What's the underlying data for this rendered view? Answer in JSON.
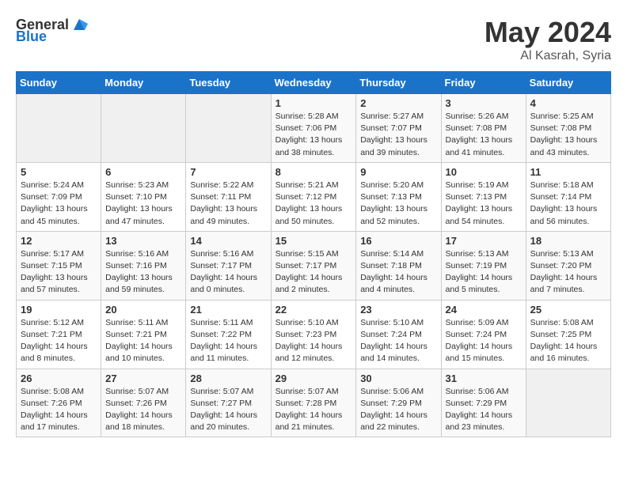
{
  "header": {
    "logo_general": "General",
    "logo_blue": "Blue",
    "title": "May 2024",
    "subtitle": "Al Kasrah, Syria"
  },
  "weekdays": [
    "Sunday",
    "Monday",
    "Tuesday",
    "Wednesday",
    "Thursday",
    "Friday",
    "Saturday"
  ],
  "weeks": [
    [
      {
        "day": "",
        "info": ""
      },
      {
        "day": "",
        "info": ""
      },
      {
        "day": "",
        "info": ""
      },
      {
        "day": "1",
        "info": "Sunrise: 5:28 AM\nSunset: 7:06 PM\nDaylight: 13 hours\nand 38 minutes."
      },
      {
        "day": "2",
        "info": "Sunrise: 5:27 AM\nSunset: 7:07 PM\nDaylight: 13 hours\nand 39 minutes."
      },
      {
        "day": "3",
        "info": "Sunrise: 5:26 AM\nSunset: 7:08 PM\nDaylight: 13 hours\nand 41 minutes."
      },
      {
        "day": "4",
        "info": "Sunrise: 5:25 AM\nSunset: 7:08 PM\nDaylight: 13 hours\nand 43 minutes."
      }
    ],
    [
      {
        "day": "5",
        "info": "Sunrise: 5:24 AM\nSunset: 7:09 PM\nDaylight: 13 hours\nand 45 minutes."
      },
      {
        "day": "6",
        "info": "Sunrise: 5:23 AM\nSunset: 7:10 PM\nDaylight: 13 hours\nand 47 minutes."
      },
      {
        "day": "7",
        "info": "Sunrise: 5:22 AM\nSunset: 7:11 PM\nDaylight: 13 hours\nand 49 minutes."
      },
      {
        "day": "8",
        "info": "Sunrise: 5:21 AM\nSunset: 7:12 PM\nDaylight: 13 hours\nand 50 minutes."
      },
      {
        "day": "9",
        "info": "Sunrise: 5:20 AM\nSunset: 7:13 PM\nDaylight: 13 hours\nand 52 minutes."
      },
      {
        "day": "10",
        "info": "Sunrise: 5:19 AM\nSunset: 7:13 PM\nDaylight: 13 hours\nand 54 minutes."
      },
      {
        "day": "11",
        "info": "Sunrise: 5:18 AM\nSunset: 7:14 PM\nDaylight: 13 hours\nand 56 minutes."
      }
    ],
    [
      {
        "day": "12",
        "info": "Sunrise: 5:17 AM\nSunset: 7:15 PM\nDaylight: 13 hours\nand 57 minutes."
      },
      {
        "day": "13",
        "info": "Sunrise: 5:16 AM\nSunset: 7:16 PM\nDaylight: 13 hours\nand 59 minutes."
      },
      {
        "day": "14",
        "info": "Sunrise: 5:16 AM\nSunset: 7:17 PM\nDaylight: 14 hours\nand 0 minutes."
      },
      {
        "day": "15",
        "info": "Sunrise: 5:15 AM\nSunset: 7:17 PM\nDaylight: 14 hours\nand 2 minutes."
      },
      {
        "day": "16",
        "info": "Sunrise: 5:14 AM\nSunset: 7:18 PM\nDaylight: 14 hours\nand 4 minutes."
      },
      {
        "day": "17",
        "info": "Sunrise: 5:13 AM\nSunset: 7:19 PM\nDaylight: 14 hours\nand 5 minutes."
      },
      {
        "day": "18",
        "info": "Sunrise: 5:13 AM\nSunset: 7:20 PM\nDaylight: 14 hours\nand 7 minutes."
      }
    ],
    [
      {
        "day": "19",
        "info": "Sunrise: 5:12 AM\nSunset: 7:21 PM\nDaylight: 14 hours\nand 8 minutes."
      },
      {
        "day": "20",
        "info": "Sunrise: 5:11 AM\nSunset: 7:21 PM\nDaylight: 14 hours\nand 10 minutes."
      },
      {
        "day": "21",
        "info": "Sunrise: 5:11 AM\nSunset: 7:22 PM\nDaylight: 14 hours\nand 11 minutes."
      },
      {
        "day": "22",
        "info": "Sunrise: 5:10 AM\nSunset: 7:23 PM\nDaylight: 14 hours\nand 12 minutes."
      },
      {
        "day": "23",
        "info": "Sunrise: 5:10 AM\nSunset: 7:24 PM\nDaylight: 14 hours\nand 14 minutes."
      },
      {
        "day": "24",
        "info": "Sunrise: 5:09 AM\nSunset: 7:24 PM\nDaylight: 14 hours\nand 15 minutes."
      },
      {
        "day": "25",
        "info": "Sunrise: 5:08 AM\nSunset: 7:25 PM\nDaylight: 14 hours\nand 16 minutes."
      }
    ],
    [
      {
        "day": "26",
        "info": "Sunrise: 5:08 AM\nSunset: 7:26 PM\nDaylight: 14 hours\nand 17 minutes."
      },
      {
        "day": "27",
        "info": "Sunrise: 5:07 AM\nSunset: 7:26 PM\nDaylight: 14 hours\nand 18 minutes."
      },
      {
        "day": "28",
        "info": "Sunrise: 5:07 AM\nSunset: 7:27 PM\nDaylight: 14 hours\nand 20 minutes."
      },
      {
        "day": "29",
        "info": "Sunrise: 5:07 AM\nSunset: 7:28 PM\nDaylight: 14 hours\nand 21 minutes."
      },
      {
        "day": "30",
        "info": "Sunrise: 5:06 AM\nSunset: 7:29 PM\nDaylight: 14 hours\nand 22 minutes."
      },
      {
        "day": "31",
        "info": "Sunrise: 5:06 AM\nSunset: 7:29 PM\nDaylight: 14 hours\nand 23 minutes."
      },
      {
        "day": "",
        "info": ""
      }
    ]
  ]
}
